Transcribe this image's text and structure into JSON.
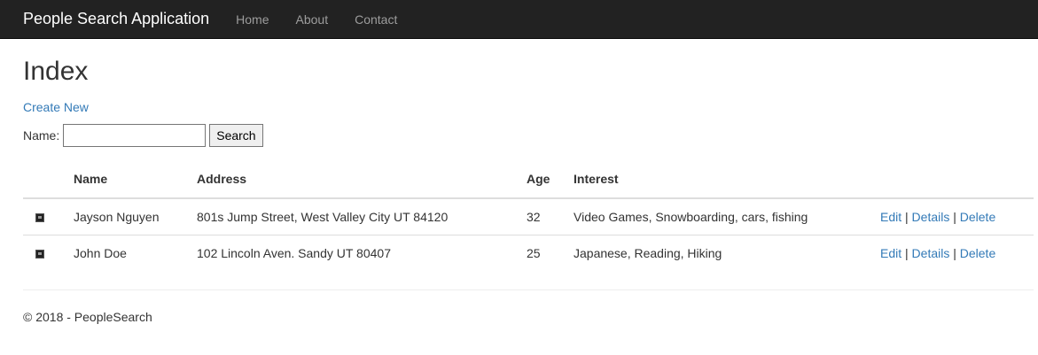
{
  "navbar": {
    "brand": "People Search Application",
    "links": [
      "Home",
      "About",
      "Contact"
    ]
  },
  "page": {
    "title": "Index",
    "create_link": "Create New"
  },
  "search": {
    "label": "Name:",
    "value": "",
    "button": "Search"
  },
  "table": {
    "headers": [
      "Name",
      "Address",
      "Age",
      "Interest"
    ],
    "rows": [
      {
        "name": "Jayson Nguyen",
        "address": "801s Jump Street, West Valley City UT 84120",
        "age": "32",
        "interest": "Video Games, Snowboarding, cars, fishing"
      },
      {
        "name": "John Doe",
        "address": "102 Lincoln Aven. Sandy UT 80407",
        "age": "25",
        "interest": "Japanese, Reading, Hiking"
      }
    ],
    "actions": {
      "edit": "Edit",
      "details": "Details",
      "delete": "Delete",
      "separator": "|"
    }
  },
  "footer": {
    "text": "© 2018 - PeopleSearch"
  }
}
